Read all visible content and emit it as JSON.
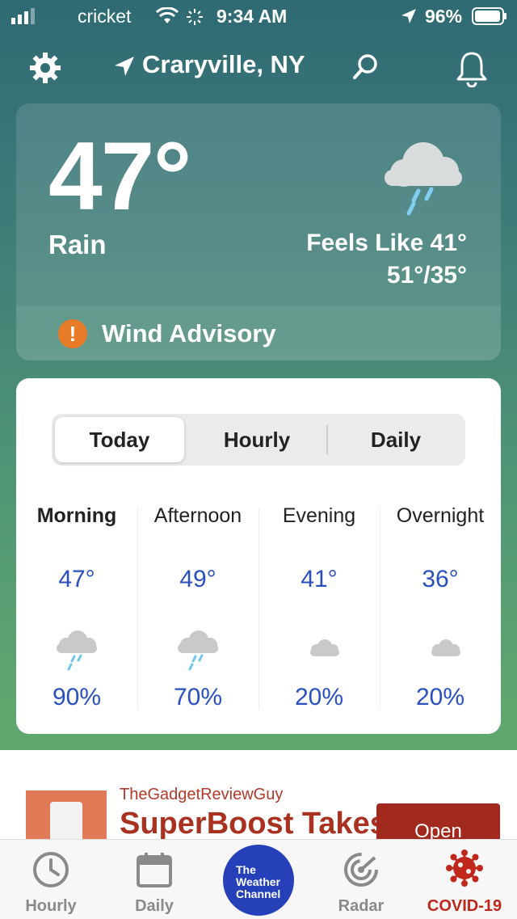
{
  "status_bar": {
    "carrier": "cricket",
    "time": "9:34 AM",
    "battery": "96%"
  },
  "header": {
    "location": "Craryville, NY"
  },
  "current": {
    "temperature": "47°",
    "condition": "Rain",
    "feels_like": "Feels Like 41°",
    "hi_lo": "51°/35°",
    "advisory": "Wind Advisory"
  },
  "forecast": {
    "tabs": [
      "Today",
      "Hourly",
      "Daily"
    ],
    "selected_tab": "Today",
    "periods": [
      {
        "name": "Morning",
        "temp": "47°",
        "icon": "rain-cloud-icon",
        "precip": "90%"
      },
      {
        "name": "Afternoon",
        "temp": "49°",
        "icon": "rain-cloud-icon",
        "precip": "70%"
      },
      {
        "name": "Evening",
        "temp": "41°",
        "icon": "partly-cloudy-night-icon",
        "precip": "20%"
      },
      {
        "name": "Overnight",
        "temp": "36°",
        "icon": "partly-cloudy-night-icon",
        "precip": "20%"
      }
    ]
  },
  "ad": {
    "brand": "TheGadgetReviewGuy",
    "headline": "SuperBoost Takes",
    "cta": "Open"
  },
  "tab_bar": {
    "items": [
      "Hourly",
      "Daily",
      "Radar",
      "COVID-19"
    ],
    "center_logo": "The Weather Channel"
  },
  "colors": {
    "accent_blue": "#2a4fbf",
    "advisory_orange": "#e87b27",
    "ad_red": "#a83120"
  }
}
